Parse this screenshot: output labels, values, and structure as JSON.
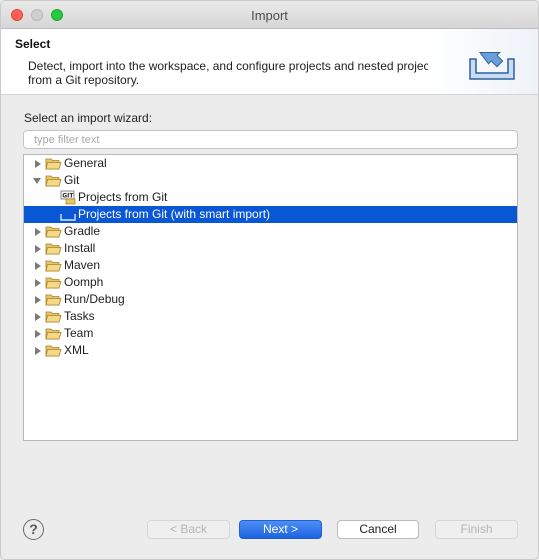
{
  "window": {
    "title": "Import"
  },
  "banner": {
    "title": "Select",
    "description": "Detect, import into the workspace, and configure projects and nested projects from a Git repository."
  },
  "wizard_label": "Select an import wizard:",
  "filter": {
    "placeholder": "type filter text",
    "value": ""
  },
  "tree": {
    "items": [
      {
        "label": "General",
        "type": "folder",
        "expanded": false
      },
      {
        "label": "Git",
        "type": "folder",
        "expanded": true
      },
      {
        "label": "Projects from Git",
        "type": "child",
        "icon": "git-repo-icon"
      },
      {
        "label": "Projects from Git (with smart import)",
        "type": "child",
        "icon": "smart-import-icon",
        "selected": true
      },
      {
        "label": "Gradle",
        "type": "folder",
        "expanded": false
      },
      {
        "label": "Install",
        "type": "folder",
        "expanded": false
      },
      {
        "label": "Maven",
        "type": "folder",
        "expanded": false
      },
      {
        "label": "Oomph",
        "type": "folder",
        "expanded": false
      },
      {
        "label": "Run/Debug",
        "type": "folder",
        "expanded": false
      },
      {
        "label": "Tasks",
        "type": "folder",
        "expanded": false
      },
      {
        "label": "Team",
        "type": "folder",
        "expanded": false
      },
      {
        "label": "XML",
        "type": "folder",
        "expanded": false
      }
    ]
  },
  "footer": {
    "help": "?",
    "back": "< Back",
    "next": "Next >",
    "cancel": "Cancel",
    "finish": "Finish"
  },
  "colors": {
    "selection": "#0a57d6",
    "default_button": "#2a6fe8"
  }
}
